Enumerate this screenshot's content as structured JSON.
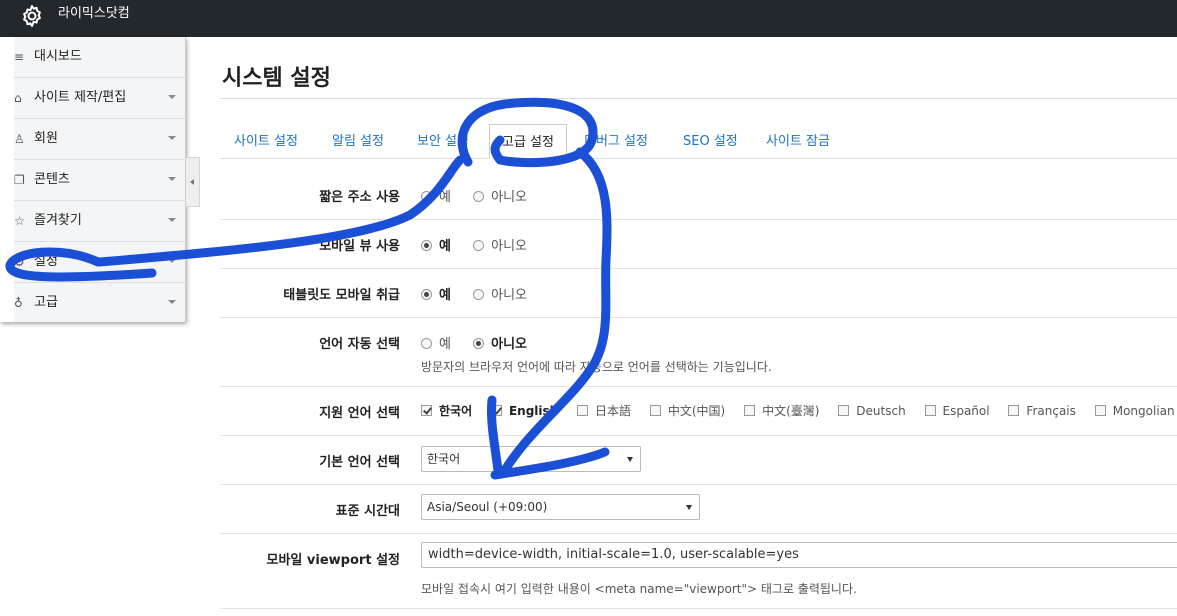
{
  "topbar": {
    "brand": "라이믹스닷컴",
    "icon": "gear-icon"
  },
  "sidebar": {
    "items": [
      {
        "label": "대시보드",
        "icon": "menu-icon",
        "has_sub": false
      },
      {
        "label": "사이트 제작/편집",
        "icon": "home-icon",
        "has_sub": true
      },
      {
        "label": "회원",
        "icon": "users-icon",
        "has_sub": true
      },
      {
        "label": "콘텐츠",
        "icon": "copy-icon",
        "has_sub": true
      },
      {
        "label": "즐겨찾기",
        "icon": "star-icon",
        "has_sub": true
      },
      {
        "label": "설정",
        "icon": "gear-icon",
        "has_sub": true
      },
      {
        "label": "고급",
        "icon": "bulb-icon",
        "has_sub": true
      }
    ]
  },
  "page": {
    "title": "시스템 설정"
  },
  "tabs": [
    {
      "label": "사이트 설정"
    },
    {
      "label": "알림 설정"
    },
    {
      "label": "보안 설정"
    },
    {
      "label": "고급 설정",
      "active": true
    },
    {
      "label": "디버그 설정"
    },
    {
      "label": "SEO 설정"
    },
    {
      "label": "사이트 잠금"
    }
  ],
  "form": {
    "short_url": {
      "label": "짧은 주소 사용",
      "yes": "예",
      "no": "아니오"
    },
    "mobile_view": {
      "label": "모바일 뷰 사용",
      "yes": "예",
      "no": "아니오"
    },
    "tablet_mobile": {
      "label": "태블릿도 모바일 취급",
      "yes": "예",
      "no": "아니오"
    },
    "auto_lang": {
      "label": "언어 자동 선택",
      "yes": "예",
      "no": "아니오",
      "help": "방문자의 브라우저 언어에 따라 자동으로 언어를 선택하는 기능입니다."
    },
    "supported_langs": {
      "label": "지원 언어 선택",
      "options": [
        "한국어",
        "English",
        "日本語",
        "中文(中国)",
        "中文(臺灣)",
        "Deutsch",
        "Español",
        "Français",
        "Mongolian"
      ]
    },
    "default_lang": {
      "label": "기본 언어 선택",
      "value": "한국어"
    },
    "timezone": {
      "label": "표준 시간대",
      "value": "Asia/Seoul (+09:00)"
    },
    "viewport": {
      "label": "모바일 viewport 설정",
      "value": "width=device-width, initial-scale=1.0, user-scalable=yes",
      "help": "모바일 접속시 여기 입력한 내용이 <meta name=\"viewport\"> 태그로 출력됩니다."
    }
  },
  "annotation_color": "#1a4fd6"
}
